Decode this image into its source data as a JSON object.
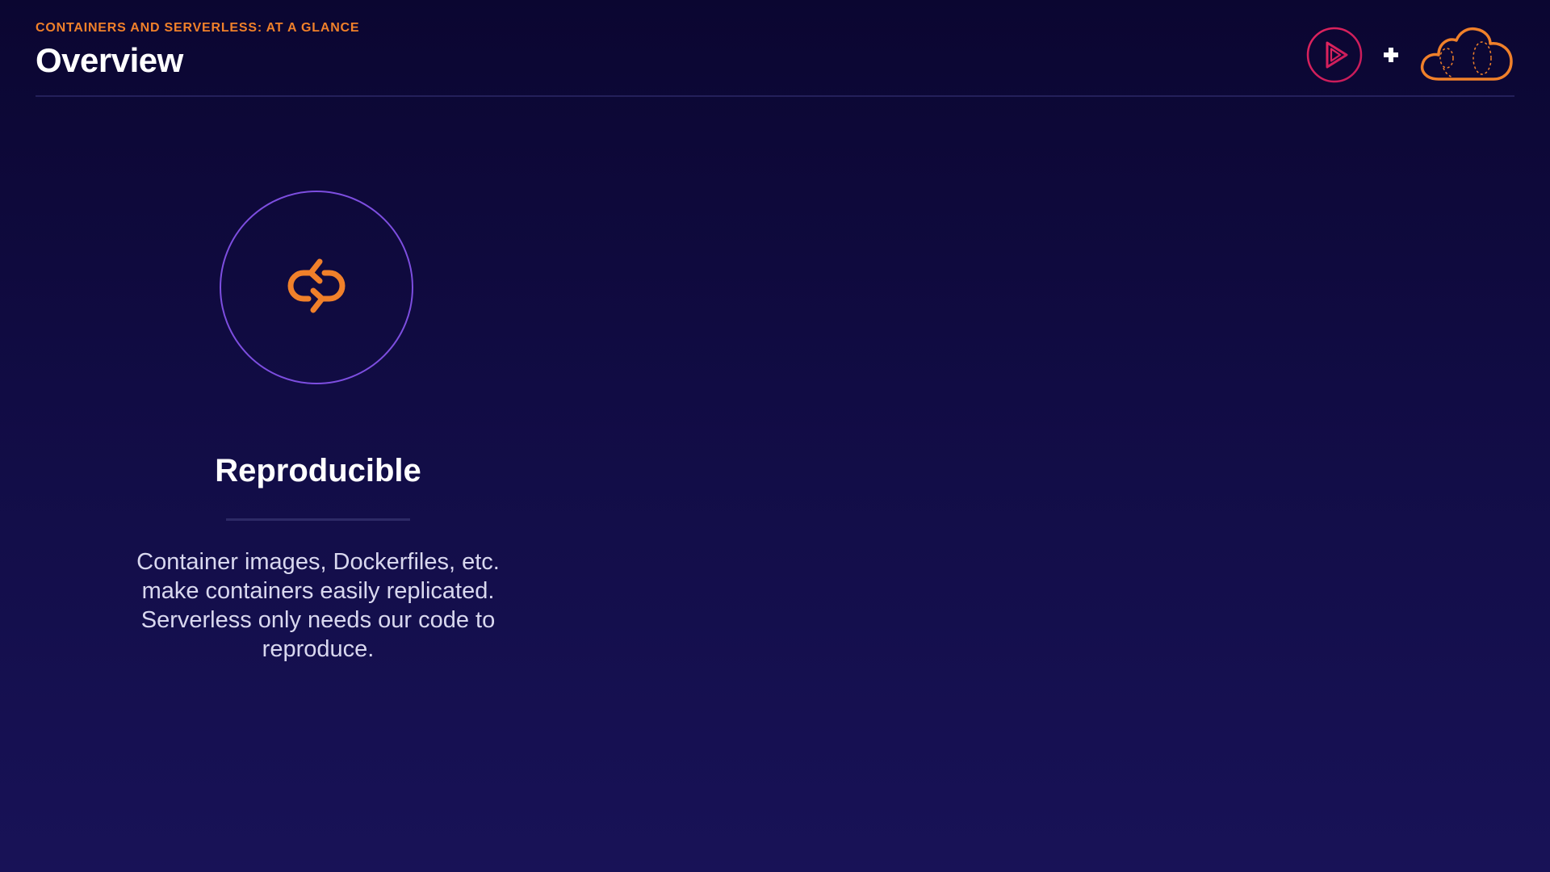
{
  "header": {
    "kicker": "CONTAINERS AND SERVERLESS: AT A GLANCE",
    "title": "Overview"
  },
  "logos": {
    "left_icon": "play-logo-icon",
    "separator": "+",
    "right_icon": "cloud-logo-icon"
  },
  "card": {
    "icon": "refresh-icon",
    "title": "Reproducible",
    "description": "Container images, Dockerfiles, etc. make containers easily replicated. Serverless only needs our code to reproduce."
  },
  "colors": {
    "accent_orange": "#f0802a",
    "circle_purple": "#7d4ee0",
    "logo_pink": "#e0245e",
    "background_top": "#0b0631",
    "background_bottom": "#181257"
  }
}
